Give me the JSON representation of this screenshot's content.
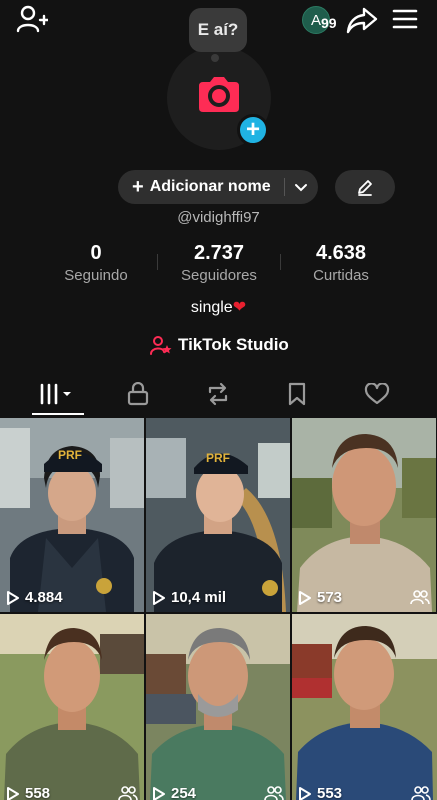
{
  "bubble": {
    "text": "E aí?"
  },
  "header": {
    "avatar_letter": "A",
    "notification_count": "99"
  },
  "profile": {
    "add_name_label": "Adicionar nome",
    "add_name_plus": "+",
    "username": "@vidighffi97",
    "bio_text": "single",
    "bio_heart": "❤"
  },
  "stats": [
    {
      "value": "0",
      "label": "Seguindo"
    },
    {
      "value": "2.737",
      "label": "Seguidores"
    },
    {
      "value": "4.638",
      "label": "Curtidas"
    }
  ],
  "studio": {
    "label": "TikTok Studio"
  },
  "tabs": [
    "videos-grid",
    "private",
    "reposts",
    "favorites",
    "liked"
  ],
  "videos": [
    {
      "views": "4.884",
      "collab": false,
      "palette": "police-woman-1"
    },
    {
      "views": "10,4 mil",
      "collab": false,
      "palette": "police-woman-2"
    },
    {
      "views": "573",
      "collab": true,
      "palette": "man-farm-1"
    },
    {
      "views": "558",
      "collab": true,
      "palette": "man-farm-2"
    },
    {
      "views": "254",
      "collab": true,
      "palette": "man-farm-3"
    },
    {
      "views": "553",
      "collab": true,
      "palette": "man-farm-4"
    }
  ],
  "colors": {
    "accent_pink": "#fe2c55",
    "accent_blue": "#20b3e3",
    "background": "#121212"
  }
}
